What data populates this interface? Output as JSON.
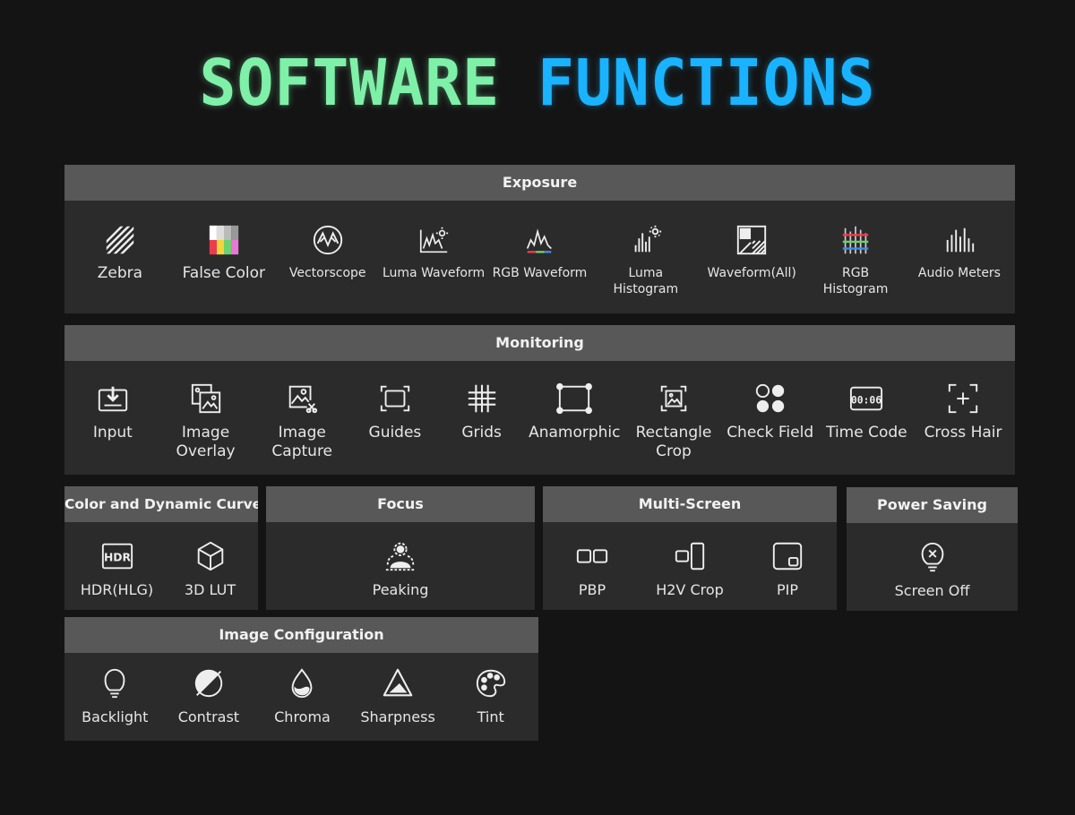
{
  "title": {
    "part1": "SOFTWARE",
    "part2": "FUNCTIONS",
    "color1": "#7ff0a8",
    "color2": "#1ab3ff"
  },
  "exposure": {
    "heading": "Exposure",
    "items": [
      {
        "label": "Zebra",
        "icon": "zebra-icon"
      },
      {
        "label": "False Color",
        "icon": "false-color-icon"
      },
      {
        "label": "Vectorscope",
        "icon": "vectorscope-icon"
      },
      {
        "label": "Luma Waveform",
        "icon": "luma-waveform-icon"
      },
      {
        "label": "RGB Waveform",
        "icon": "rgb-waveform-icon"
      },
      {
        "label": "Luma Histogram",
        "icon": "luma-histogram-icon"
      },
      {
        "label": "Waveform(All)",
        "icon": "waveform-all-icon"
      },
      {
        "label": "RGB\nHistogram",
        "icon": "rgb-histogram-icon"
      },
      {
        "label": "Audio Meters",
        "icon": "audio-meters-icon"
      }
    ]
  },
  "monitoring": {
    "heading": "Monitoring",
    "items": [
      {
        "label": "Input",
        "icon": "input-icon"
      },
      {
        "label": "Image\nOverlay",
        "icon": "image-overlay-icon"
      },
      {
        "label": "Image\nCapture",
        "icon": "image-capture-icon"
      },
      {
        "label": "Guides",
        "icon": "guides-icon"
      },
      {
        "label": "Grids",
        "icon": "grids-icon"
      },
      {
        "label": "Anamorphic",
        "icon": "anamorphic-icon"
      },
      {
        "label": "Rectangle\nCrop",
        "icon": "rectangle-crop-icon"
      },
      {
        "label": "Check Field",
        "icon": "check-field-icon"
      },
      {
        "label": "Time Code",
        "icon": "time-code-icon"
      },
      {
        "label": "Cross Hair",
        "icon": "cross-hair-icon"
      }
    ]
  },
  "color_curve": {
    "heading": "Color and Dynamic Curve",
    "items": [
      {
        "label": "HDR(HLG)",
        "icon": "hdr-icon",
        "badge": "HDR"
      },
      {
        "label": "3D LUT",
        "icon": "cube-icon"
      }
    ]
  },
  "focus": {
    "heading": "Focus",
    "items": [
      {
        "label": "Peaking",
        "icon": "peaking-icon"
      }
    ]
  },
  "multi_screen": {
    "heading": "Multi-Screen",
    "items": [
      {
        "label": "PBP",
        "icon": "pbp-icon"
      },
      {
        "label": "H2V Crop",
        "icon": "h2v-crop-icon"
      },
      {
        "label": "PIP",
        "icon": "pip-icon"
      }
    ]
  },
  "power_saving": {
    "heading": "Power Saving",
    "items": [
      {
        "label": "Screen Off",
        "icon": "screen-off-icon"
      }
    ]
  },
  "image_config": {
    "heading": "Image Configuration",
    "items": [
      {
        "label": "Backlight",
        "icon": "backlight-icon"
      },
      {
        "label": "Contrast",
        "icon": "contrast-icon"
      },
      {
        "label": "Chroma",
        "icon": "chroma-icon"
      },
      {
        "label": "Sharpness",
        "icon": "sharpness-icon"
      },
      {
        "label": "Tint",
        "icon": "tint-icon"
      }
    ]
  },
  "time_code_digits": "00:06"
}
